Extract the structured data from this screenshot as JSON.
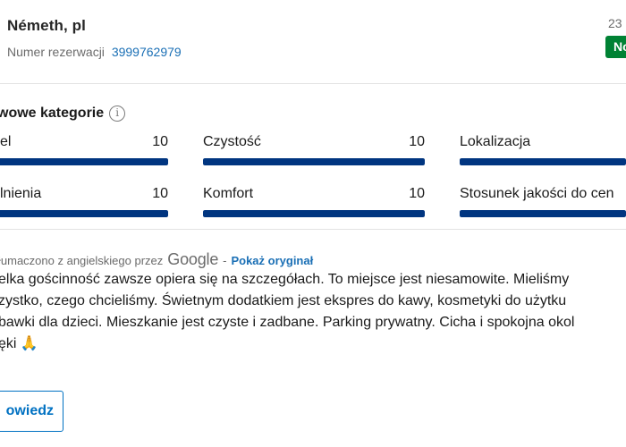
{
  "header": {
    "guest_name": "Németh, pl",
    "reservation_label": "Numer rezerwacji",
    "reservation_number": "3999762979",
    "date_partial": "23",
    "badge": "No"
  },
  "categories": {
    "title": "wowe kategorie",
    "items": [
      {
        "label": "el",
        "score": "10",
        "fill": 1.0
      },
      {
        "label": "Czystość",
        "score": "10",
        "fill": 1.0
      },
      {
        "label": "Lokalizacja",
        "score": "",
        "fill": 1.0
      },
      {
        "label": "lnienia",
        "score": "10",
        "fill": 1.0
      },
      {
        "label": "Komfort",
        "score": "10",
        "fill": 1.0
      },
      {
        "label": "Stosunek jakości do cen",
        "score": "",
        "fill": 1.0
      }
    ]
  },
  "translation": {
    "prefix": "łumaczono z angielskiego przez",
    "engine": "Google",
    "separator": "-",
    "show_original": "Pokaż oryginał"
  },
  "review": {
    "lines": [
      "elka gościnność zawsze opiera się na szczegółach. To miejsce jest niesamowite. Mieliśmy",
      "zystko, czego chcieliśmy. Świetnym dodatkiem jest ekspres do kawy, kosmetyki do użytku",
      "bawki dla dzieci. Mieszkanie jest czyste i zadbane. Parking prywatny. Cicha i spokojna okol",
      "ęki 🙏"
    ]
  },
  "actions": {
    "reply_label": "owiedz"
  },
  "colors": {
    "accent_blue": "#1a6fb5",
    "bar_navy": "#003580",
    "badge_green": "#008234"
  }
}
